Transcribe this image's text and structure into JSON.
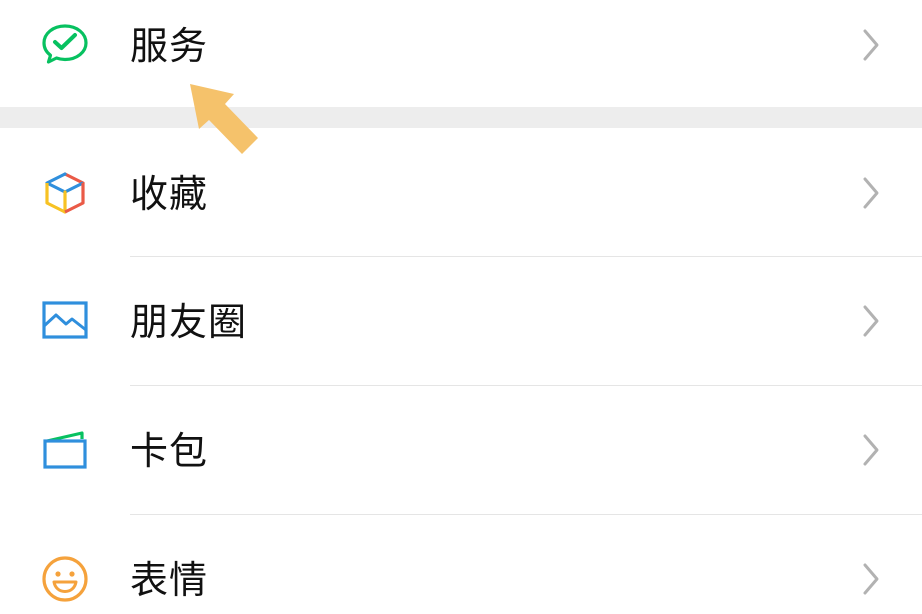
{
  "colors": {
    "background": "#ffffff",
    "group_gap": "#ededed",
    "divider": "#e5e5e5",
    "label": "#111111",
    "chevron": "#b2b2b2",
    "services_green": "#07c160",
    "favorites_red": "#ea5a47",
    "favorites_yellow": "#f7c223",
    "favorites_blue": "#2f8fdd",
    "moments_blue": "#2f8fdd",
    "cards_blue": "#2f8fdd",
    "cards_green": "#07c160",
    "stickers_orange": "#f5a23c",
    "hint_arrow": "#f5c26b"
  },
  "menu": {
    "services": {
      "label": "服务",
      "icon": "chat-check-icon"
    },
    "favorites": {
      "label": "收藏",
      "icon": "cube-icon"
    },
    "moments": {
      "label": "朋友圈",
      "icon": "picture-icon"
    },
    "cards": {
      "label": "卡包",
      "icon": "card-wallet-icon"
    },
    "stickers": {
      "label": "表情",
      "icon": "smiley-icon"
    }
  },
  "chevron_icon": "chevron-right-icon",
  "hint_icon": "pointer-arrow-icon"
}
